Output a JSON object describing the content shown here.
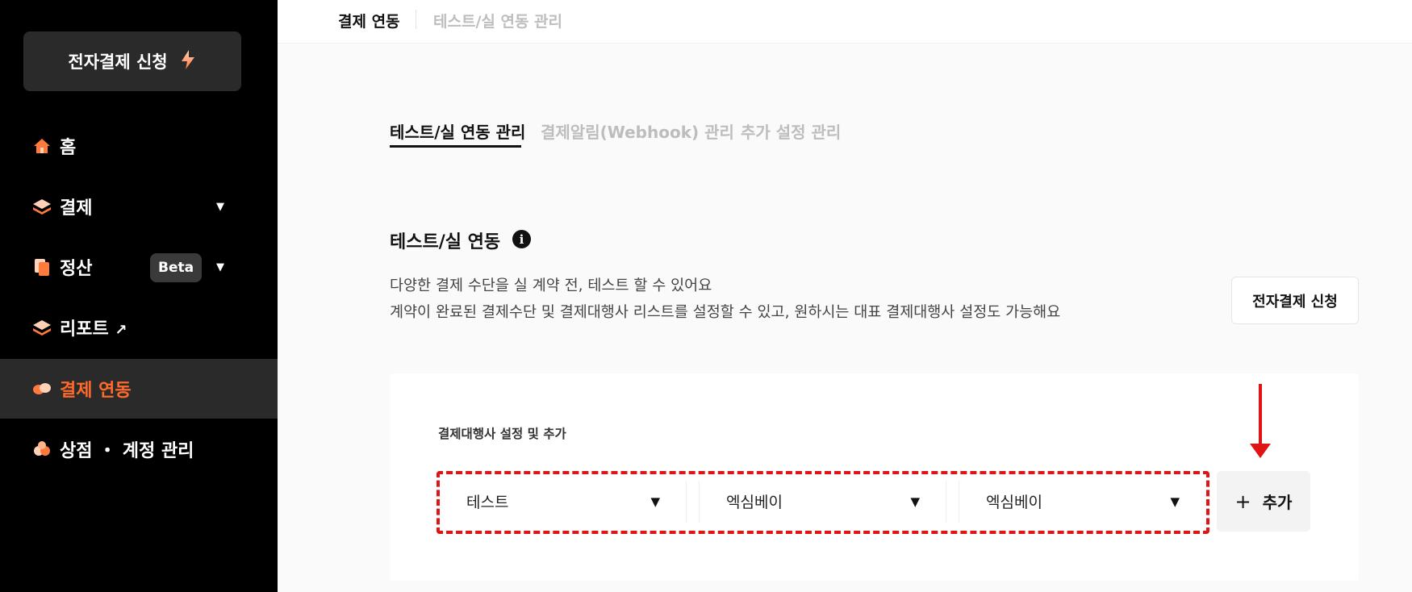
{
  "sidebar": {
    "apply_button": {
      "label": "전자결제 신청",
      "icon": "lightning-icon"
    },
    "items": [
      {
        "label": "홈",
        "icon": "home-icon"
      },
      {
        "label": "결제",
        "icon": "layers-icon",
        "caret": "▼"
      },
      {
        "label": "정산",
        "icon": "documents-icon",
        "badge": "Beta",
        "caret": "▼"
      },
      {
        "label": "리포트",
        "icon": "layers-icon",
        "external": "↗"
      },
      {
        "label": "결제 연동",
        "icon": "pills-icon",
        "active": true
      },
      {
        "label": "상점 ・ 계정 관리",
        "icon": "store-icon"
      }
    ],
    "active_color": "#ff6a2b"
  },
  "topbar": {
    "crumb_current": "결제 연동",
    "crumb_link": "테스트/실 연동 관리"
  },
  "tabs": [
    {
      "label": "테스트/실 연동 관리",
      "active": true
    },
    {
      "label": "결제알림(Webhook) 관리",
      "active": false
    },
    {
      "label": "추가 설정 관리",
      "active": false
    }
  ],
  "section": {
    "title": "테스트/실 연동",
    "info_icon": "info-icon",
    "desc_1": "다양한 결제 수단을 실 계약 전, 테스트 할 수 있어요",
    "desc_2": "계약이 완료된 결제수단 및 결제대행사 리스트를 설정할 수 있고, 원하시는 대표 결제대행사 설정도 가능해요",
    "apply_button": "전자결제 신청"
  },
  "card": {
    "label": "결제대행사 설정 및 추가",
    "selects": [
      {
        "value": "테스트",
        "arrow": "▼"
      },
      {
        "value": "엑심베이",
        "arrow": "▼"
      },
      {
        "value": "엑심베이",
        "arrow": "▼"
      }
    ],
    "add_button": {
      "plus": "+",
      "label": "추가"
    },
    "highlight_color": "#e01414"
  }
}
